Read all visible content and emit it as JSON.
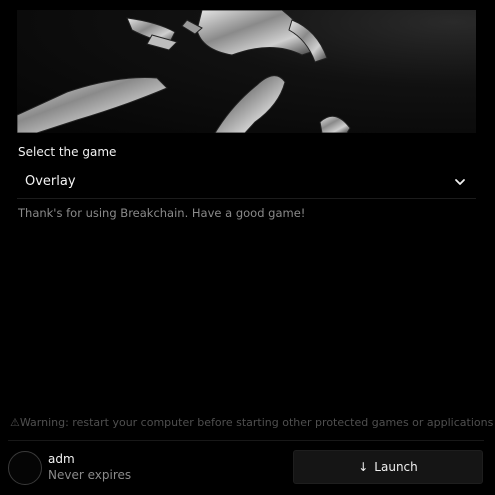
{
  "banner": {
    "image": "abstract-chrome-chain-links"
  },
  "game_select": {
    "label": "Select the game",
    "selected": "Overlay"
  },
  "message": "Thank's for using Breakchain. Have a good game!",
  "warning": "⚠Warning: restart your computer before starting other protected games or applications!",
  "user": {
    "name": "adm",
    "subscription": "Never expires"
  },
  "launch": {
    "icon": "↓",
    "label": "Launch"
  },
  "colors": {
    "background": "#000000",
    "button": "#151515",
    "muted_text": "#8a8a8a",
    "warning_text": "#4f4f4f"
  }
}
